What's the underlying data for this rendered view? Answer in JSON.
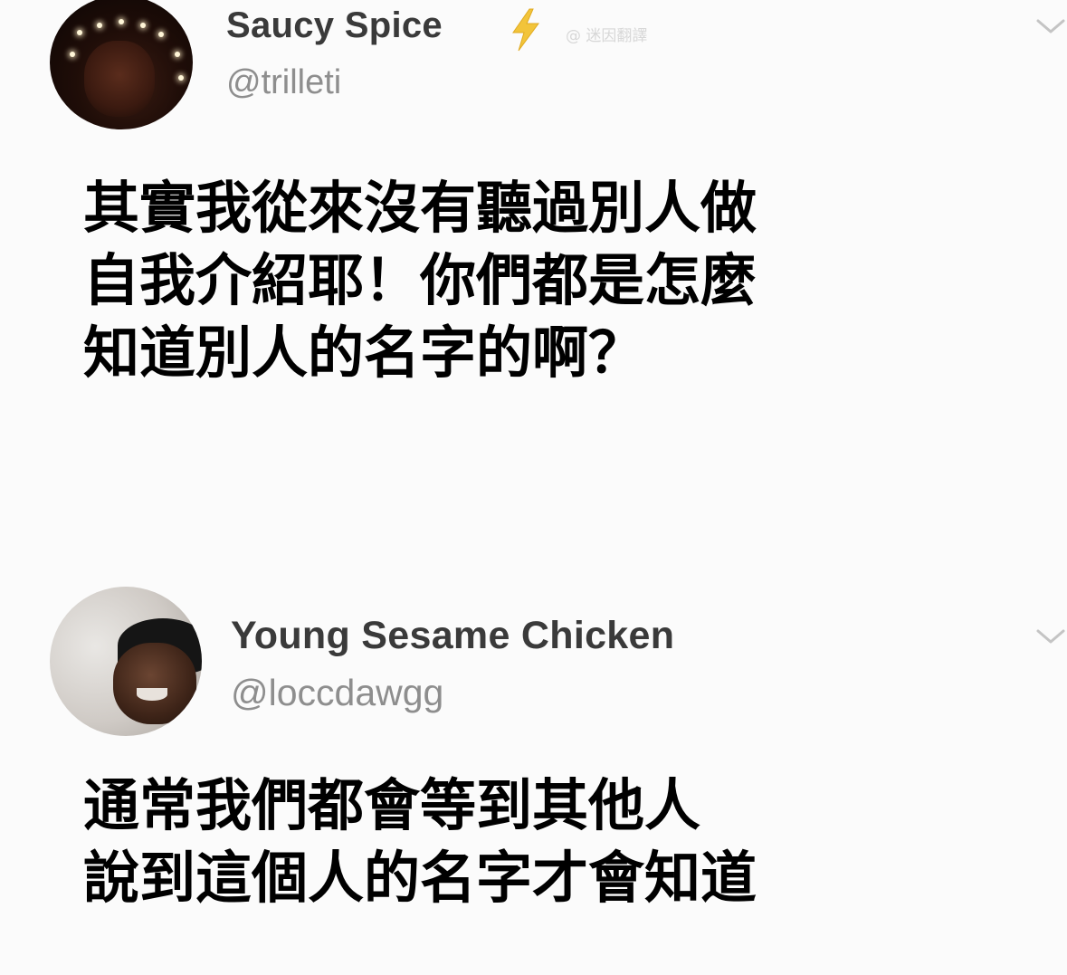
{
  "tweets": [
    {
      "display_name": "Saucy Spice",
      "handle": "@trilleti",
      "watermark": "@ 迷因翻譯",
      "text_lines": [
        "其實我從來沒有聽過別人做",
        "自我介紹耶！你們都是怎麼",
        "知道別人的名字的啊？"
      ],
      "avatar": "profile-photo",
      "badge_icon": "lightning-icon"
    },
    {
      "display_name": "Young Sesame Chicken",
      "handle": "@loccdawgg",
      "text_lines": [
        "通常我們都會等到其他人",
        "說到這個人的名字才會知道"
      ],
      "avatar": "profile-photo"
    }
  ],
  "icons": {
    "menu": "chevron-down-icon"
  },
  "colors": {
    "name": "#3a3a3a",
    "handle": "#8e8e8e",
    "text": "#000000",
    "lightning": "#f2c43a"
  }
}
